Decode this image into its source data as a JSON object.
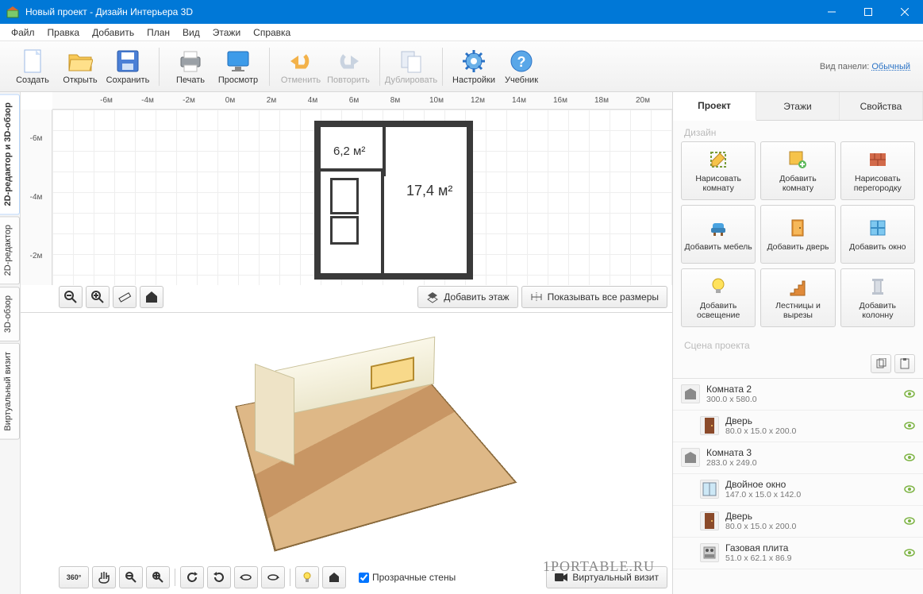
{
  "window": {
    "title": "Новый проект - Дизайн Интерьера 3D"
  },
  "menu": [
    "Файл",
    "Правка",
    "Добавить",
    "План",
    "Вид",
    "Этажи",
    "Справка"
  ],
  "toolbar": {
    "create": "Создать",
    "open": "Открыть",
    "save": "Сохранить",
    "print": "Печать",
    "preview": "Просмотр",
    "undo": "Отменить",
    "redo": "Повторить",
    "duplicate": "Дублировать",
    "settings": "Настройки",
    "tutorial": "Учебник",
    "panel_label": "Вид панели:",
    "panel_mode": "Обычный"
  },
  "side_tabs": [
    "2D-редактор и 3D-обзор",
    "2D-редактор",
    "3D-обзор",
    "Виртуальный визит"
  ],
  "ruler_h": [
    "-6м",
    "-4м",
    "-2м",
    "0м",
    "2м",
    "4м",
    "6м",
    "8м",
    "10м",
    "12м",
    "14м",
    "16м",
    "18м",
    "20м"
  ],
  "ruler_v": [
    "-6м",
    "-4м",
    "-2м"
  ],
  "plan": {
    "room_small_area": "6,2 м²",
    "room_big_area": "17,4 м²"
  },
  "view2d_buttons": {
    "add_floor": "Добавить этаж",
    "show_dims": "Показывать все размеры"
  },
  "view3d_buttons": {
    "transparent_walls": "Прозрачные стены",
    "virtual_visit": "Виртуальный визит"
  },
  "right_panel": {
    "tabs": [
      "Проект",
      "Этажи",
      "Свойства"
    ],
    "design_label": "Дизайн",
    "buttons": [
      "Нарисовать комнату",
      "Добавить комнату",
      "Нарисовать перегородку",
      "Добавить мебель",
      "Добавить дверь",
      "Добавить окно",
      "Добавить освещение",
      "Лестницы и вырезы",
      "Добавить колонну"
    ],
    "scene_label": "Сцена проекта"
  },
  "objects": [
    {
      "name": "Комната 2",
      "dims": "300.0 x 580.0",
      "indent": false,
      "icon": "room"
    },
    {
      "name": "Дверь",
      "dims": "80.0 x 15.0 x 200.0",
      "indent": true,
      "icon": "door"
    },
    {
      "name": "Комната 3",
      "dims": "283.0 x 249.0",
      "indent": false,
      "icon": "room"
    },
    {
      "name": "Двойное окно",
      "dims": "147.0 x 15.0 x 142.0",
      "indent": true,
      "icon": "window"
    },
    {
      "name": "Дверь",
      "dims": "80.0 x 15.0 x 200.0",
      "indent": true,
      "icon": "door"
    },
    {
      "name": "Газовая плита",
      "dims": "51.0 x 62.1 x 86.9",
      "indent": true,
      "icon": "stove"
    }
  ],
  "watermark": "1PORTABLE.RU"
}
